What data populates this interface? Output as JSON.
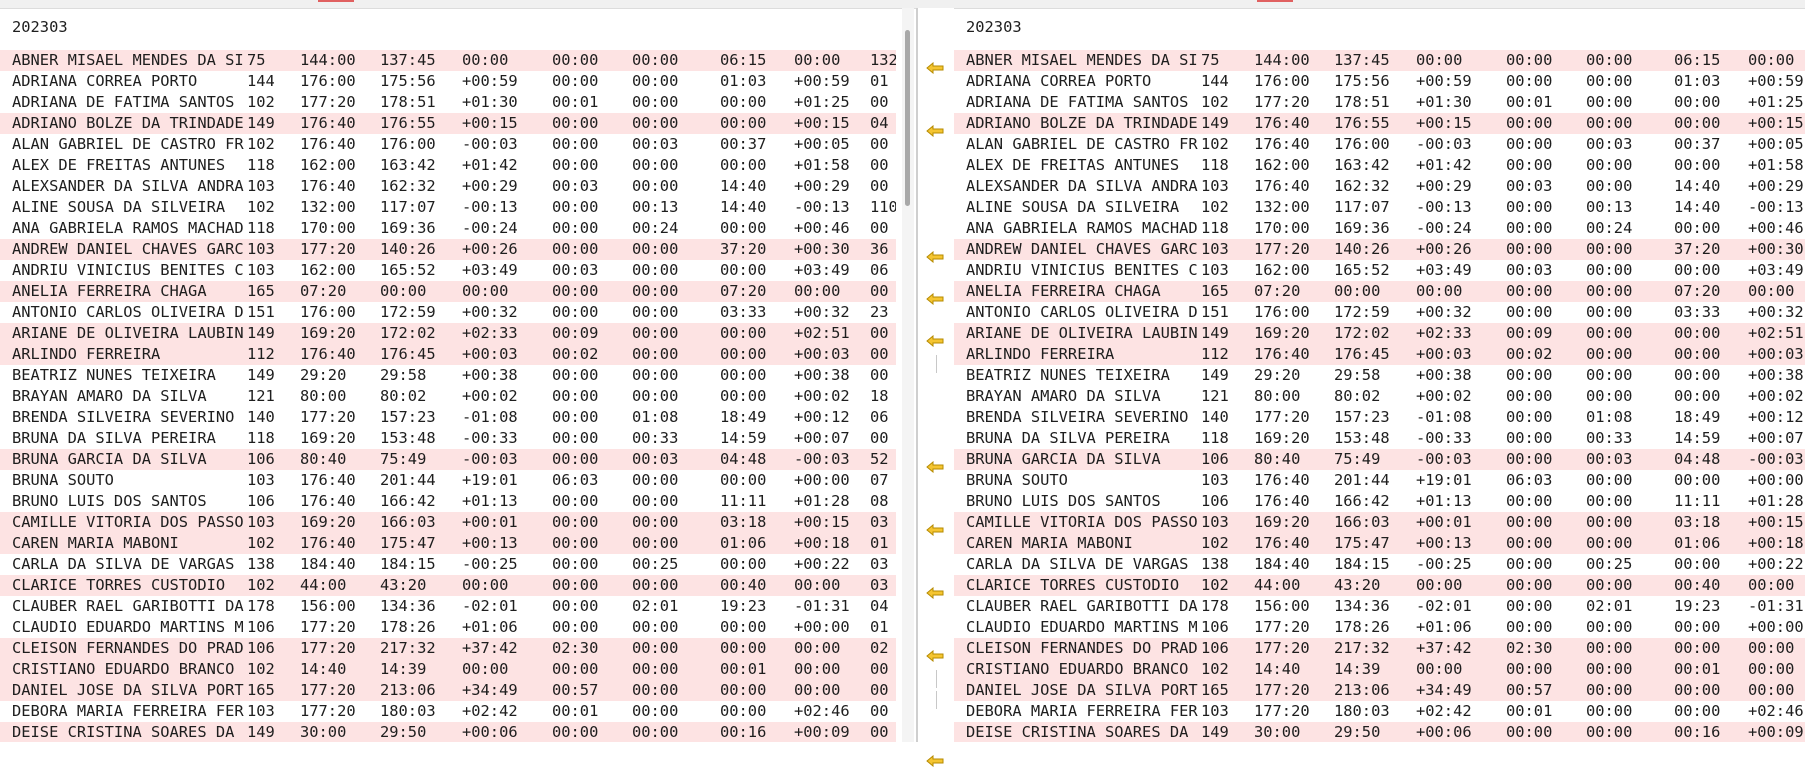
{
  "left": {
    "period": "202303",
    "rows": [
      {
        "name": "ABNER MISAEL MENDES DA SI",
        "code": "75",
        "t": [
          "144:00",
          "137:45",
          "00:00",
          "00:00",
          "00:00",
          "06:15",
          "00:00"
        ],
        "last": "132",
        "diff": true
      },
      {
        "name": "ADRIANA CORREA PORTO",
        "code": "144",
        "t": [
          "176:00",
          "175:56",
          "+00:59",
          "00:00",
          "00:00",
          "01:03",
          "+00:59"
        ],
        "last": "01",
        "diff": false
      },
      {
        "name": "ADRIANA DE FATIMA SANTOS",
        "code": "102",
        "t": [
          "177:20",
          "178:51",
          "+01:30",
          "00:01",
          "00:00",
          "00:00",
          "+01:25"
        ],
        "last": "00",
        "diff": false
      },
      {
        "name": "ADRIANO BOLZE DA TRINDADE",
        "code": "149",
        "t": [
          "176:40",
          "176:55",
          "+00:15",
          "00:00",
          "00:00",
          "00:00",
          "+00:15"
        ],
        "last": "04",
        "diff": true
      },
      {
        "name": "ALAN GABRIEL DE CASTRO FR",
        "code": "102",
        "t": [
          "176:40",
          "176:00",
          "-00:03",
          "00:00",
          "00:03",
          "00:37",
          "+00:05"
        ],
        "last": "00",
        "diff": false
      },
      {
        "name": "ALEX DE FREITAS ANTUNES",
        "code": "118",
        "t": [
          "162:00",
          "163:42",
          "+01:42",
          "00:00",
          "00:00",
          "00:00",
          "+01:58"
        ],
        "last": "00",
        "diff": false
      },
      {
        "name": "ALEXSANDER DA SILVA ANDRA",
        "code": "103",
        "t": [
          "176:40",
          "162:32",
          "+00:29",
          "00:03",
          "00:00",
          "14:40",
          "+00:29"
        ],
        "last": "00",
        "diff": false
      },
      {
        "name": "ALINE SOUSA DA SILVEIRA",
        "code": "102",
        "t": [
          "132:00",
          "117:07",
          "-00:13",
          "00:00",
          "00:13",
          "14:40",
          "-00:13"
        ],
        "last": "110",
        "diff": false
      },
      {
        "name": "ANA GABRIELA RAMOS MACHAD",
        "code": "118",
        "t": [
          "170:00",
          "169:36",
          "-00:24",
          "00:00",
          "00:24",
          "00:00",
          "+00:46"
        ],
        "last": "00",
        "diff": false
      },
      {
        "name": "ANDREW DANIEL CHAVES GARC",
        "code": "103",
        "t": [
          "177:20",
          "140:26",
          "+00:26",
          "00:00",
          "00:00",
          "37:20",
          "+00:30"
        ],
        "last": "36",
        "diff": true
      },
      {
        "name": "ANDRIU VINICIUS BENITES C",
        "code": "103",
        "t": [
          "162:00",
          "165:52",
          "+03:49",
          "00:03",
          "00:00",
          "00:00",
          "+03:49"
        ],
        "last": "06",
        "diff": false
      },
      {
        "name": "ANELIA FERREIRA CHAGA",
        "code": "165",
        "t": [
          "07:20",
          "00:00",
          "00:00",
          "00:00",
          "00:00",
          "07:20",
          "00:00"
        ],
        "last": "00",
        "diff": true
      },
      {
        "name": "ANTONIO CARLOS OLIVEIRA D",
        "code": "151",
        "t": [
          "176:00",
          "172:59",
          "+00:32",
          "00:00",
          "00:00",
          "03:33",
          "+00:32"
        ],
        "last": "23",
        "diff": false
      },
      {
        "name": "ARIANE DE OLIVEIRA LAUBIN",
        "code": "149",
        "t": [
          "169:20",
          "172:02",
          "+02:33",
          "00:09",
          "00:00",
          "00:00",
          "+02:51"
        ],
        "last": "00",
        "diff": true
      },
      {
        "name": "ARLINDO FERREIRA",
        "code": "112",
        "t": [
          "176:40",
          "176:45",
          "+00:03",
          "00:02",
          "00:00",
          "00:00",
          "+00:03"
        ],
        "last": "00",
        "diff": true
      },
      {
        "name": "BEATRIZ NUNES TEIXEIRA",
        "code": "149",
        "t": [
          "29:20",
          "29:58",
          "+00:38",
          "00:00",
          "00:00",
          "00:00",
          "+00:38"
        ],
        "last": "00",
        "diff": false
      },
      {
        "name": "BRAYAN AMARO DA SILVA",
        "code": "121",
        "t": [
          "80:00",
          "80:02",
          "+00:02",
          "00:00",
          "00:00",
          "00:00",
          "+00:02"
        ],
        "last": "18",
        "diff": false
      },
      {
        "name": "BRENDA SILVEIRA SEVERINO",
        "code": "140",
        "t": [
          "177:20",
          "157:23",
          "-01:08",
          "00:00",
          "01:08",
          "18:49",
          "+00:12"
        ],
        "last": "06",
        "diff": false
      },
      {
        "name": "BRUNA DA SILVA PEREIRA",
        "code": "118",
        "t": [
          "169:20",
          "153:48",
          "-00:33",
          "00:00",
          "00:33",
          "14:59",
          "+00:07"
        ],
        "last": "00",
        "diff": false
      },
      {
        "name": "BRUNA GARCIA DA SILVA",
        "code": "106",
        "t": [
          "80:40",
          "75:49",
          "-00:03",
          "00:00",
          "00:03",
          "04:48",
          "-00:03"
        ],
        "last": "52",
        "diff": true
      },
      {
        "name": "BRUNA SOUTO",
        "code": "103",
        "t": [
          "176:40",
          "201:44",
          "+19:01",
          "06:03",
          "00:00",
          "00:00",
          "+00:00"
        ],
        "last": "07",
        "diff": false
      },
      {
        "name": "BRUNO LUIS DOS SANTOS",
        "code": "106",
        "t": [
          "176:40",
          "166:42",
          "+01:13",
          "00:00",
          "00:00",
          "11:11",
          "+01:28"
        ],
        "last": "08",
        "diff": false
      },
      {
        "name": "CAMILLE VITORIA DOS PASSO",
        "code": "103",
        "t": [
          "169:20",
          "166:03",
          "+00:01",
          "00:00",
          "00:00",
          "03:18",
          "+00:15"
        ],
        "last": "03",
        "diff": true
      },
      {
        "name": "CAREN MARIA MABONI",
        "code": "102",
        "t": [
          "176:40",
          "175:47",
          "+00:13",
          "00:00",
          "00:00",
          "01:06",
          "+00:18"
        ],
        "last": "01",
        "diff": true
      },
      {
        "name": "CARLA DA SILVA DE VARGAS",
        "code": "138",
        "t": [
          "184:40",
          "184:15",
          "-00:25",
          "00:00",
          "00:25",
          "00:00",
          "+00:22"
        ],
        "last": "03",
        "diff": false
      },
      {
        "name": "CLARICE TORRES CUSTODIO",
        "code": "102",
        "t": [
          "44:00",
          "43:20",
          "00:00",
          "00:00",
          "00:00",
          "00:40",
          "00:00"
        ],
        "last": "03",
        "diff": true
      },
      {
        "name": "CLAUBER RAEL GARIBOTTI DA",
        "code": "178",
        "t": [
          "156:00",
          "134:36",
          "-02:01",
          "00:00",
          "02:01",
          "19:23",
          "-01:31"
        ],
        "last": "04",
        "diff": false
      },
      {
        "name": "CLAUDIO EDUARDO MARTINS M",
        "code": "106",
        "t": [
          "177:20",
          "178:26",
          "+01:06",
          "00:00",
          "00:00",
          "00:00",
          "+00:00"
        ],
        "last": "01",
        "diff": false
      },
      {
        "name": "CLEISON FERNANDES DO PRAD",
        "code": "106",
        "t": [
          "177:20",
          "217:32",
          "+37:42",
          "02:30",
          "00:00",
          "00:00",
          "00:00"
        ],
        "last": "02",
        "diff": true
      },
      {
        "name": "CRISTIANO EDUARDO BRANCO",
        "code": "102",
        "t": [
          "14:40",
          "14:39",
          "00:00",
          "00:00",
          "00:00",
          "00:01",
          "00:00"
        ],
        "last": "00",
        "diff": true
      },
      {
        "name": "DANIEL JOSE DA SILVA PORT",
        "code": "165",
        "t": [
          "177:20",
          "213:06",
          "+34:49",
          "00:57",
          "00:00",
          "00:00",
          "00:00"
        ],
        "last": "00",
        "diff": true
      },
      {
        "name": "DEBORA MARIA FERREIRA FER",
        "code": "103",
        "t": [
          "177:20",
          "180:03",
          "+02:42",
          "00:01",
          "00:00",
          "00:00",
          "+02:46"
        ],
        "last": "00",
        "diff": false
      },
      {
        "name": "DEISE CRISTINA SOARES DA",
        "code": "149",
        "t": [
          "30:00",
          "29:50",
          "+00:06",
          "00:00",
          "00:00",
          "00:16",
          "+00:09"
        ],
        "last": "00",
        "diff": true
      }
    ]
  },
  "right": {
    "period": "202303",
    "rows": [
      {
        "name": "ABNER MISAEL MENDES DA SI",
        "code": "75",
        "t": [
          "144:00",
          "137:45",
          "00:00",
          "00:00",
          "00:00",
          "06:15",
          "00:00"
        ],
        "diff": true
      },
      {
        "name": "ADRIANA CORREA PORTO",
        "code": "144",
        "t": [
          "176:00",
          "175:56",
          "+00:59",
          "00:00",
          "00:00",
          "01:03",
          "+00:59"
        ],
        "diff": false
      },
      {
        "name": "ADRIANA DE FATIMA SANTOS",
        "code": "102",
        "t": [
          "177:20",
          "178:51",
          "+01:30",
          "00:01",
          "00:00",
          "00:00",
          "+01:25"
        ],
        "diff": false
      },
      {
        "name": "ADRIANO BOLZE DA TRINDADE",
        "code": "149",
        "t": [
          "176:40",
          "176:55",
          "+00:15",
          "00:00",
          "00:00",
          "00:00",
          "+00:15"
        ],
        "diff": true
      },
      {
        "name": "ALAN GABRIEL DE CASTRO FR",
        "code": "102",
        "t": [
          "176:40",
          "176:00",
          "-00:03",
          "00:00",
          "00:03",
          "00:37",
          "+00:05"
        ],
        "diff": false
      },
      {
        "name": "ALEX DE FREITAS ANTUNES",
        "code": "118",
        "t": [
          "162:00",
          "163:42",
          "+01:42",
          "00:00",
          "00:00",
          "00:00",
          "+01:58"
        ],
        "diff": false
      },
      {
        "name": "ALEXSANDER DA SILVA ANDRA",
        "code": "103",
        "t": [
          "176:40",
          "162:32",
          "+00:29",
          "00:03",
          "00:00",
          "14:40",
          "+00:29"
        ],
        "diff": false
      },
      {
        "name": "ALINE SOUSA DA SILVEIRA",
        "code": "102",
        "t": [
          "132:00",
          "117:07",
          "-00:13",
          "00:00",
          "00:13",
          "14:40",
          "-00:13"
        ],
        "diff": false
      },
      {
        "name": "ANA GABRIELA RAMOS MACHAD",
        "code": "118",
        "t": [
          "170:00",
          "169:36",
          "-00:24",
          "00:00",
          "00:24",
          "00:00",
          "+00:46"
        ],
        "diff": false
      },
      {
        "name": "ANDREW DANIEL CHAVES GARC",
        "code": "103",
        "t": [
          "177:20",
          "140:26",
          "+00:26",
          "00:00",
          "00:00",
          "37:20",
          "+00:30"
        ],
        "diff": true
      },
      {
        "name": "ANDRIU VINICIUS BENITES C",
        "code": "103",
        "t": [
          "162:00",
          "165:52",
          "+03:49",
          "00:03",
          "00:00",
          "00:00",
          "+03:49"
        ],
        "diff": false
      },
      {
        "name": "ANELIA FERREIRA CHAGA",
        "code": "165",
        "t": [
          "07:20",
          "00:00",
          "00:00",
          "00:00",
          "00:00",
          "07:20",
          "00:00"
        ],
        "diff": true
      },
      {
        "name": "ANTONIO CARLOS OLIVEIRA D",
        "code": "151",
        "t": [
          "176:00",
          "172:59",
          "+00:32",
          "00:00",
          "00:00",
          "03:33",
          "+00:32"
        ],
        "diff": false
      },
      {
        "name": "ARIANE DE OLIVEIRA LAUBIN",
        "code": "149",
        "t": [
          "169:20",
          "172:02",
          "+02:33",
          "00:09",
          "00:00",
          "00:00",
          "+02:51"
        ],
        "diff": true
      },
      {
        "name": "ARLINDO FERREIRA",
        "code": "112",
        "t": [
          "176:40",
          "176:45",
          "+00:03",
          "00:02",
          "00:00",
          "00:00",
          "+00:03"
        ],
        "diff": true
      },
      {
        "name": "BEATRIZ NUNES TEIXEIRA",
        "code": "149",
        "t": [
          "29:20",
          "29:58",
          "+00:38",
          "00:00",
          "00:00",
          "00:00",
          "+00:38"
        ],
        "diff": false
      },
      {
        "name": "BRAYAN AMARO DA SILVA",
        "code": "121",
        "t": [
          "80:00",
          "80:02",
          "+00:02",
          "00:00",
          "00:00",
          "00:00",
          "+00:02"
        ],
        "diff": false
      },
      {
        "name": "BRENDA SILVEIRA SEVERINO",
        "code": "140",
        "t": [
          "177:20",
          "157:23",
          "-01:08",
          "00:00",
          "01:08",
          "18:49",
          "+00:12"
        ],
        "diff": false
      },
      {
        "name": "BRUNA DA SILVA PEREIRA",
        "code": "118",
        "t": [
          "169:20",
          "153:48",
          "-00:33",
          "00:00",
          "00:33",
          "14:59",
          "+00:07"
        ],
        "diff": false
      },
      {
        "name": "BRUNA GARCIA DA SILVA",
        "code": "106",
        "t": [
          "80:40",
          "75:49",
          "-00:03",
          "00:00",
          "00:03",
          "04:48",
          "-00:03"
        ],
        "diff": true
      },
      {
        "name": "BRUNA SOUTO",
        "code": "103",
        "t": [
          "176:40",
          "201:44",
          "+19:01",
          "06:03",
          "00:00",
          "00:00",
          "+00:00"
        ],
        "diff": false
      },
      {
        "name": "BRUNO LUIS DOS SANTOS",
        "code": "106",
        "t": [
          "176:40",
          "166:42",
          "+01:13",
          "00:00",
          "00:00",
          "11:11",
          "+01:28"
        ],
        "diff": false
      },
      {
        "name": "CAMILLE VITORIA DOS PASSO",
        "code": "103",
        "t": [
          "169:20",
          "166:03",
          "+00:01",
          "00:00",
          "00:00",
          "03:18",
          "+00:15"
        ],
        "diff": true
      },
      {
        "name": "CAREN MARIA MABONI",
        "code": "102",
        "t": [
          "176:40",
          "175:47",
          "+00:13",
          "00:00",
          "00:00",
          "01:06",
          "+00:18"
        ],
        "diff": true
      },
      {
        "name": "CARLA DA SILVA DE VARGAS",
        "code": "138",
        "t": [
          "184:40",
          "184:15",
          "-00:25",
          "00:00",
          "00:25",
          "00:00",
          "+00:22"
        ],
        "diff": false
      },
      {
        "name": "CLARICE TORRES CUSTODIO",
        "code": "102",
        "t": [
          "44:00",
          "43:20",
          "00:00",
          "00:00",
          "00:00",
          "00:40",
          "00:00"
        ],
        "diff": true
      },
      {
        "name": "CLAUBER RAEL GARIBOTTI DA",
        "code": "178",
        "t": [
          "156:00",
          "134:36",
          "-02:01",
          "00:00",
          "02:01",
          "19:23",
          "-01:31"
        ],
        "diff": false
      },
      {
        "name": "CLAUDIO EDUARDO MARTINS M",
        "code": "106",
        "t": [
          "177:20",
          "178:26",
          "+01:06",
          "00:00",
          "00:00",
          "00:00",
          "+00:00"
        ],
        "diff": false
      },
      {
        "name": "CLEISON FERNANDES DO PRAD",
        "code": "106",
        "t": [
          "177:20",
          "217:32",
          "+37:42",
          "02:30",
          "00:00",
          "00:00",
          "00:00"
        ],
        "diff": true
      },
      {
        "name": "CRISTIANO EDUARDO BRANCO",
        "code": "102",
        "t": [
          "14:40",
          "14:39",
          "00:00",
          "00:00",
          "00:00",
          "00:01",
          "00:00"
        ],
        "diff": true
      },
      {
        "name": "DANIEL JOSE DA SILVA PORT",
        "code": "165",
        "t": [
          "177:20",
          "213:06",
          "+34:49",
          "00:57",
          "00:00",
          "00:00",
          "00:00"
        ],
        "diff": true
      },
      {
        "name": "DEBORA MARIA FERREIRA FER",
        "code": "103",
        "t": [
          "177:20",
          "180:03",
          "+02:42",
          "00:01",
          "00:00",
          "00:00",
          "+02:46"
        ],
        "diff": false
      },
      {
        "name": "DEISE CRISTINA SOARES DA",
        "code": "149",
        "t": [
          "30:00",
          "29:50",
          "+00:06",
          "00:00",
          "00:00",
          "00:16",
          "+00:09"
        ],
        "diff": true
      }
    ]
  },
  "gutter": {
    "arrow_rows": [
      0,
      3,
      9,
      11,
      13,
      19,
      22,
      25,
      28,
      33
    ],
    "line_rows": [
      14,
      29,
      30
    ],
    "arrow_icon": "copy-left-arrow-icon"
  },
  "colors": {
    "diff_row": "#fde3e3",
    "arrow_fill": "#f5c531",
    "arrow_stroke": "#b58a00"
  }
}
